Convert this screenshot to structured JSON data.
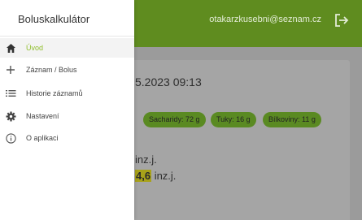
{
  "header": {
    "user_email": "otakarzkusebni@seznam.cz",
    "logout_icon": "logout-icon"
  },
  "record": {
    "datetime": "5.2023 09:13",
    "chips": [
      {
        "label": "Sacharidy: 72 g"
      },
      {
        "label": "Tuky: 16 g"
      },
      {
        "label": "Bílkoviny: 11 g"
      }
    ],
    "line1_unit": "inz.j.",
    "line2_value": "4,6",
    "line2_unit": " inz.j."
  },
  "drawer": {
    "title": "Boluskalkulátor",
    "items": [
      {
        "label": "Úvod",
        "icon": "home-icon",
        "active": true
      },
      {
        "label": "Záznam / Bolus",
        "icon": "plus-icon",
        "active": false
      },
      {
        "label": "Historie záznamů",
        "icon": "list-icon",
        "active": false
      },
      {
        "label": "Nastavení",
        "icon": "gear-icon",
        "active": false
      },
      {
        "label": "O aplikaci",
        "icon": "info-icon",
        "active": false
      }
    ]
  },
  "colors": {
    "appbar": "#5f8c1f",
    "active_label": "#8fbe2a",
    "chip": "#5a8a22",
    "highlight": "#a8a21a"
  }
}
